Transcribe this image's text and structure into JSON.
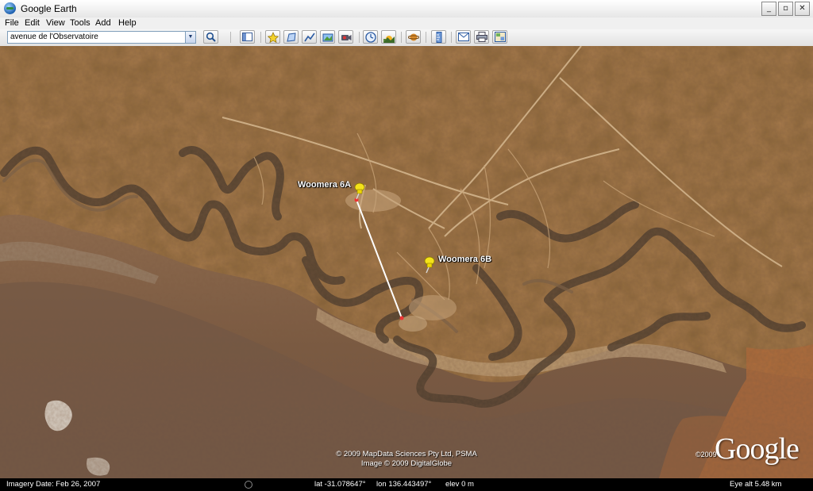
{
  "window": {
    "title": "Google Earth",
    "minimize": "_",
    "maximize": "▫",
    "close": "✕"
  },
  "menu": [
    "File",
    "Edit",
    "View",
    "Tools",
    "Add",
    "Help"
  ],
  "search": {
    "value": "avenue de l'Observatoire"
  },
  "toolbar_icons": [
    "search-icon",
    "sidebar-icon",
    "placemark-icon",
    "polygon-icon",
    "path-icon",
    "image-overlay-icon",
    "record-tour-icon",
    "historical-imagery-icon",
    "sunlight-icon",
    "planets-icon",
    "ruler-icon",
    "email-icon",
    "print-icon",
    "view-in-maps-icon"
  ],
  "placemarks": [
    {
      "label": "Woomera 6A"
    },
    {
      "label": "Woomera 6B"
    }
  ],
  "colors": {
    "pin": "#f4e21a",
    "ruler_line": "#ffffff"
  },
  "attribution": {
    "line1": "© 2009 MapData Sciences Pty Ltd, PSMA",
    "line2": "Image © 2009 DigitalGlobe",
    "logo": "Google",
    "logo_year": "©2009"
  },
  "status": {
    "imagery_date": "Imagery Date: Feb 26, 2007",
    "lat": "lat  -31.078647°",
    "lon": "lon  136.443497°",
    "elev": "elev    0 m",
    "eye_alt": "Eye alt     5.48 km"
  }
}
